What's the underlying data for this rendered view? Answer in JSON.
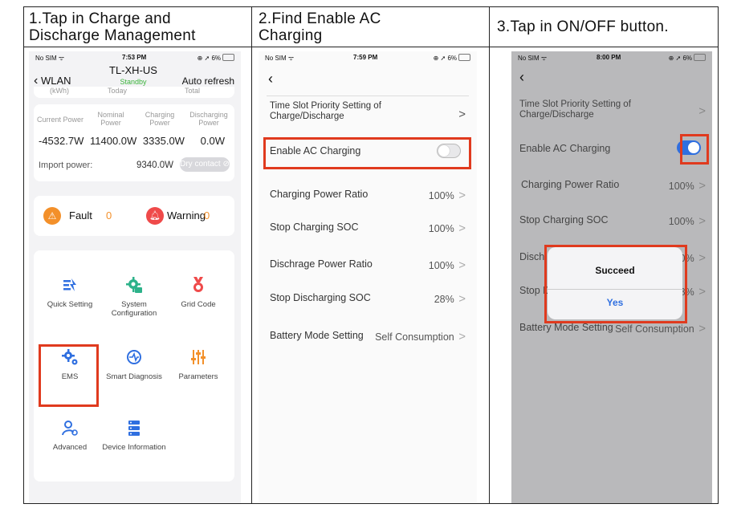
{
  "steps": {
    "s1_line1": "1.Tap in Charge and",
    "s1_line2": "Discharge Management",
    "s2_line1": "2.Find Enable AC",
    "s2_line2": "Charging",
    "s3": "3.Tap in ON/OFF button."
  },
  "screen1": {
    "status": {
      "carrier": "No SIM",
      "time": "7:53 PM",
      "battery": "6%"
    },
    "nav": {
      "back": "WLAN",
      "device": "TL-XH-US",
      "state": "Standby",
      "auto_refresh": "Auto refresh"
    },
    "partial_row": {
      "a": "(kWh)",
      "b": "Today",
      "c": "Total"
    },
    "power_headers": [
      "Current Power",
      "Nominal Power",
      "Charging Power",
      "Discharging Power"
    ],
    "power_values": [
      "-4532.7W",
      "11400.0W",
      "3335.0W",
      "0.0W"
    ],
    "import_label": "Import power:",
    "import_value": "9340.0W",
    "dry_contact": "Dry contact",
    "fault_label": "Fault",
    "fault_count": "0",
    "warning_label": "Warning",
    "warning_count": "0",
    "menu": [
      {
        "label": "Quick Setting",
        "icon": "quick-setting-icon"
      },
      {
        "label": "System Configuration",
        "icon": "system-config-icon"
      },
      {
        "label": "Grid Code",
        "icon": "grid-code-icon"
      },
      {
        "label": "EMS",
        "icon": "ems-icon"
      },
      {
        "label": "Smart Diagnosis",
        "icon": "smart-diagnosis-icon"
      },
      {
        "label": "Parameters",
        "icon": "parameters-icon"
      },
      {
        "label": "Advanced",
        "icon": "advanced-icon"
      },
      {
        "label": "Device Information",
        "icon": "device-info-icon"
      }
    ]
  },
  "screen2": {
    "status": {
      "carrier": "No SIM",
      "time": "7:59 PM",
      "battery": "6%"
    },
    "rows": {
      "time_slot": "Time Slot Priority Setting of Charge/Discharge",
      "enable_ac": "Enable AC Charging",
      "charging_ratio": "Charging Power Ratio",
      "charging_ratio_val": "100%",
      "stop_charging": "Stop Charging SOC",
      "stop_charging_val": "100%",
      "discharge_ratio": "Dischrage Power Ratio",
      "discharge_ratio_val": "100%",
      "stop_discharging": "Stop Discharging SOC",
      "stop_discharging_val": "28%",
      "battery_mode": "Battery Mode Setting",
      "battery_mode_val": "Self Consumption"
    },
    "toggle_on": false
  },
  "screen3": {
    "status": {
      "carrier": "No SIM",
      "time": "8:00 PM",
      "battery": "6%"
    },
    "toggle_on": true,
    "dialog": {
      "title": "Succeed",
      "button": "Yes"
    },
    "partial": {
      "disch": "Disch",
      "disch_val": "0%",
      "stop_d": "Stop D",
      "stop_d_val": "8%"
    }
  },
  "colors": {
    "highlight": "#e03a1e",
    "toggle_on": "#2f6fe0",
    "standby": "#3bb33b",
    "accent_orange": "#f3902a",
    "accent_red": "#ef4a4a",
    "icon_blue": "#2f6fe0",
    "icon_green": "#2db28a"
  }
}
